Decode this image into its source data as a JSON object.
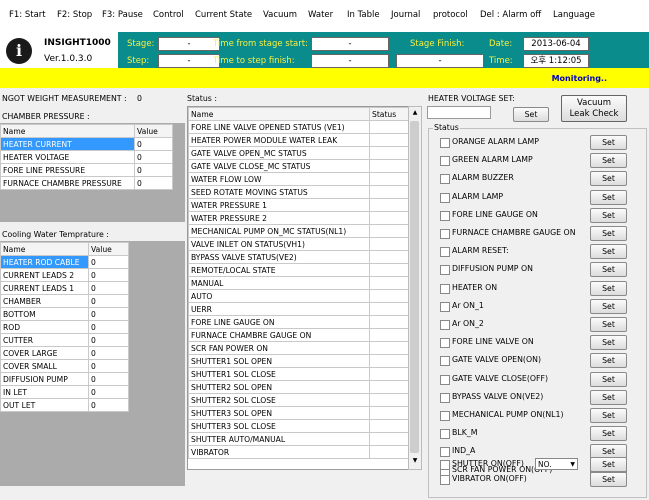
{
  "menu": [
    "F1: Start",
    "F2: Stop",
    "F3: Pause",
    "Control",
    "Current State",
    "Vacuum",
    "Water",
    "In Table",
    "Journal",
    "protocol",
    "Del : Alarm off",
    "Language"
  ],
  "app": {
    "name": "INSIGHT1000",
    "version": "Ver.1.0.3.0",
    "logo_letter": "i"
  },
  "header": {
    "stage_label": "Stage:",
    "stage_value": "-",
    "step_label": "Step:",
    "step_value": "-",
    "time_stage_label": "Time from stage start:",
    "time_stage_value": "-",
    "time_step_label": "Time to step finish:",
    "time_step_value": "-",
    "stage_finish_label": "Stage Finish:",
    "stage_finish_value": "-",
    "date_label": "Date:",
    "date_value": "2013-06-04",
    "time_label": "Time:",
    "time_value": "오후 1:12:05"
  },
  "monitoring": "Monitoring..",
  "ingot": {
    "label": "NGOT WEIGHT MEASUREMENT :",
    "value": "0"
  },
  "chamber": {
    "title": "CHAMBER PRESSURE :",
    "col_name": "Name",
    "col_value": "Value",
    "rows": [
      {
        "name": "HEATER CURRENT",
        "value": "0"
      },
      {
        "name": "HEATER VOLTAGE",
        "value": "0"
      },
      {
        "name": "FORE LINE PRESSURE",
        "value": "0"
      },
      {
        "name": "FURNACE CHAMBRE PRESSURE",
        "value": "0"
      }
    ]
  },
  "cooling": {
    "title": "Cooling Water Temprature :",
    "col_name": "Name",
    "col_value": "Value",
    "rows": [
      {
        "name": "HEATER ROD CABLE",
        "value": "0"
      },
      {
        "name": "CURRENT LEADS 2",
        "value": "0"
      },
      {
        "name": "CURRENT LEADS 1",
        "value": "0"
      },
      {
        "name": "CHAMBER",
        "value": "0"
      },
      {
        "name": "BOTTOM",
        "value": "0"
      },
      {
        "name": "ROD",
        "value": "0"
      },
      {
        "name": "CUTTER",
        "value": "0"
      },
      {
        "name": "COVER LARGE",
        "value": "0"
      },
      {
        "name": "COVER SMALL",
        "value": "0"
      },
      {
        "name": "DIFFUSION PUMP",
        "value": "0"
      },
      {
        "name": "IN LET",
        "value": "0"
      },
      {
        "name": "OUT LET",
        "value": "0"
      }
    ]
  },
  "status": {
    "title": "Status :",
    "col_name": "Name",
    "col_status": "Status",
    "rows": [
      "FORE LINE VALVE OPENED STATUS (VE1)",
      "HEATER POWER MODULE WATER LEAK",
      "GATE VALVE OPEN_MC STATUS",
      "GATE VALVE CLOSE_MC STATUS",
      "WATER FLOW LOW",
      "SEED ROTATE MOVING STATUS",
      "WATER PRESSURE 1",
      "WATER PRESSURE 2",
      "MECHANICAL PUMP ON_MC STATUS(NL1)",
      "VALVE INLET ON STATUS(VH1)",
      "BYPASS VALVE STATUS(VE2)",
      "REMOTE/LOCAL STATE",
      "MANUAL",
      "AUTO",
      "UERR",
      "FORE LINE GAUGE ON",
      "FURNACE CHAMBRE GAUGE ON",
      "SCR FAN POWER ON",
      "SHUTTER1 SOL OPEN",
      "SHUTTER1 SOL CLOSE",
      "SHUTTER2 SOL OPEN",
      "SHUTTER2 SOL CLOSE",
      "SHUTTER3 SOL OPEN",
      "SHUTTER3 SOL CLOSE",
      "SHUTTER AUTO/MANUAL",
      "VIBRATOR"
    ]
  },
  "heater": {
    "label": "HEATER VOLTAGE SET:",
    "input_value": "",
    "set": "Set",
    "leak_check_line1": "Vacuum",
    "leak_check_line2": "Leak Check"
  },
  "controls": {
    "title": "Status",
    "set": "Set",
    "items": [
      "ORANGE ALARM LAMP",
      "GREEN ALARM LAMP",
      "ALARM BUZZER",
      "ALARM LAMP",
      "FORE LINE GAUGE ON",
      "FURNACE CHAMBRE GAUGE ON",
      "ALARM RESET:",
      "DIFFUSION PUMP ON",
      "HEATER ON",
      "Ar ON_1",
      "Ar ON_2",
      "FORE LINE VALVE ON",
      "GATE VALVE OPEN(ON)",
      "GATE VALVE CLOSE(OFF)",
      "BYPASS VALVE ON(VE2)",
      "MECHANICAL PUMP ON(NL1)",
      "BLK_M",
      "IND_A",
      "SCR FAN POWER ON(OFF)"
    ],
    "shutter_label": "SHUTTER ON(OFF)",
    "shutter_select": "NO.",
    "vibrator_label": "VIBRATOR ON(OFF)"
  },
  "colors": {
    "teal": "#0a8c8c",
    "yellow_label": "#f8f040",
    "highlight": "#ffff00",
    "selection": "#3399ff"
  }
}
